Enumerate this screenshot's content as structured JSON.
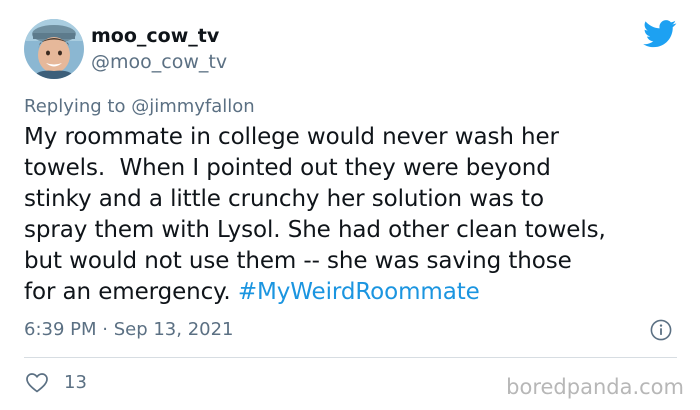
{
  "user": {
    "display_name": "moo_cow_tv",
    "handle": "@moo_cow_tv"
  },
  "reply": {
    "prefix": "Replying to ",
    "mention": "@jimmyfallon"
  },
  "tweet": {
    "text": "My roommate in college would never wash her\ntowels.  When I pointed out they were beyond\nstinky and a little crunchy her solution was to\nspray them with Lysol. She had other clean towels,\nbut would not use them -- she was saving those\nfor an emergency. ",
    "hashtag": "#MyWeirdRoommate",
    "timestamp": "6:39 PM · Sep 13, 2021"
  },
  "actions": {
    "like_count": "13"
  },
  "watermark": "boredpanda.com",
  "icons": {
    "brand": "twitter-bird-icon",
    "info": "info-icon",
    "like": "heart-icon"
  },
  "colors": {
    "brand_blue": "#1da1f2",
    "hashtag_blue": "#1b95e0",
    "secondary_text": "#5b7083",
    "primary_text": "#0f1419",
    "divider": "#d7dde2",
    "watermark": "#b7b7b7"
  }
}
